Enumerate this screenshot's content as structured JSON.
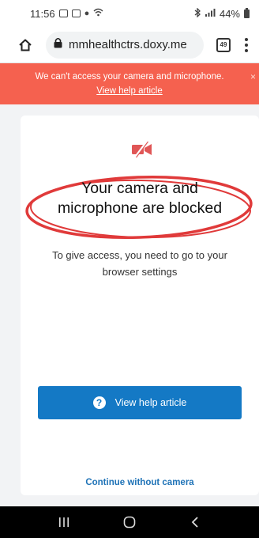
{
  "status_bar": {
    "time": "11:56",
    "battery": "44%"
  },
  "browser": {
    "url": "mmhealthctrs.doxy.me",
    "tab_count": "49"
  },
  "banner": {
    "message": "We can't access your camera and microphone.",
    "link": "View help article",
    "close": "×"
  },
  "card": {
    "title_line1": "Your camera and",
    "title_line2": "microphone are blocked",
    "desc_line1": "To give access, you need to go to your",
    "desc_line2": "browser settings",
    "help_button": "View help article",
    "help_icon_glyph": "?",
    "continue_link": "Continue without camera"
  },
  "colors": {
    "banner": "#f5614f",
    "button": "#1479c5",
    "link": "#1f73b7",
    "highlight": "#e03a3a",
    "icon_red": "#e05656"
  }
}
